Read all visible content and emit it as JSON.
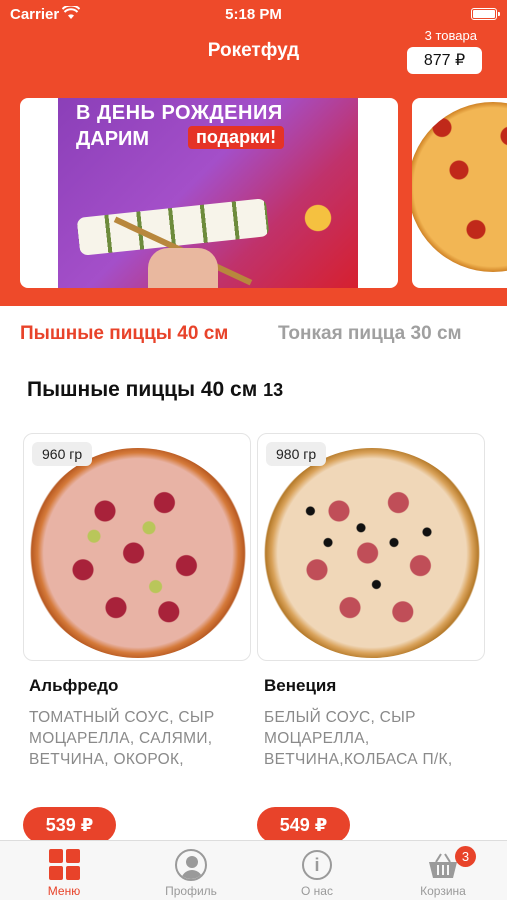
{
  "status_bar": {
    "carrier": "Carrier",
    "time": "5:18 PM"
  },
  "header": {
    "title": "Рокетфуд",
    "cart_count": "3 товара",
    "cart_total": "877 ₽"
  },
  "banners": [
    {
      "line1": "В ДЕНЬ РОЖДЕНИЯ",
      "line2": "ДАРИМ",
      "highlight": "подарки!"
    },
    {}
  ],
  "categories": [
    {
      "label": "Пышные пиццы 40 см",
      "active": true
    },
    {
      "label": "Тонкая пицца   30 см",
      "active": false
    }
  ],
  "section": {
    "title": "Пышные пиццы 40 см",
    "count": "13"
  },
  "products": [
    {
      "weight": "960 гр",
      "name": "Альфредо",
      "description": "ТОМАТНЫЙ СОУС, СЫР МОЦАРЕЛЛА, САЛЯМИ, ВЕТЧИНА, ОКОРОК,",
      "price": "539 ₽"
    },
    {
      "weight": "980 гр",
      "name": "Венеция",
      "description": "БЕЛЫЙ СОУС, СЫР МОЦАРЕЛЛА, ВЕТЧИНА,КОЛБАСА П/К,",
      "price": "549 ₽"
    }
  ],
  "tabbar": [
    {
      "label": "Меню",
      "icon": "menu-grid-icon",
      "active": true
    },
    {
      "label": "Профиль",
      "icon": "profile-icon"
    },
    {
      "label": "О нас",
      "icon": "info-icon"
    },
    {
      "label": "Корзина",
      "icon": "basket-icon",
      "badge": "3"
    }
  ],
  "colors": {
    "accent": "#e8432a",
    "header_bg": "#ee4a2a",
    "muted": "#9a9a9a"
  }
}
